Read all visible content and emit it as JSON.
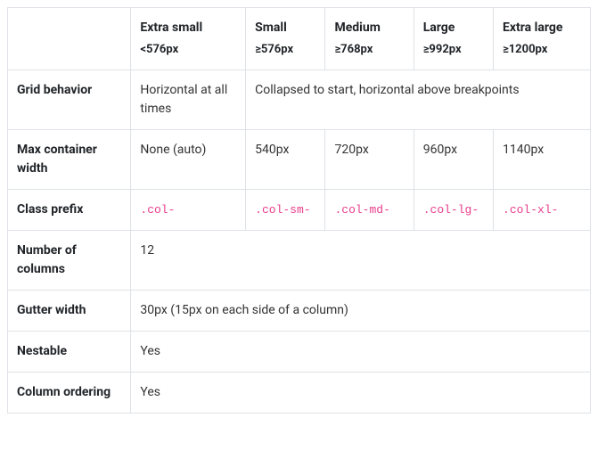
{
  "headers": {
    "xs": {
      "title": "Extra small",
      "sub": "<576px"
    },
    "sm": {
      "title": "Small",
      "sub": "≥576px"
    },
    "md": {
      "title": "Medium",
      "sub": "≥768px"
    },
    "lg": {
      "title": "Large",
      "sub": "≥992px"
    },
    "xl": {
      "title": "Extra large",
      "sub": "≥1200px"
    }
  },
  "rows": {
    "grid_behavior": {
      "label": "Grid behavior",
      "xs": "Horizontal at all times",
      "rest": "Collapsed to start, horizontal above breakpoints"
    },
    "max_width": {
      "label": "Max container width",
      "xs": "None (auto)",
      "sm": "540px",
      "md": "720px",
      "lg": "960px",
      "xl": "1140px"
    },
    "class_prefix": {
      "label": "Class prefix",
      "xs": ".col-",
      "sm": ".col-sm-",
      "md": ".col-md-",
      "lg": ".col-lg-",
      "xl": ".col-xl-"
    },
    "num_columns": {
      "label": "Number of columns",
      "value": "12"
    },
    "gutter_width": {
      "label": "Gutter width",
      "value": "30px (15px on each side of a column)"
    },
    "nestable": {
      "label": "Nestable",
      "value": "Yes"
    },
    "column_ordering": {
      "label": "Column ordering",
      "value": "Yes"
    }
  }
}
